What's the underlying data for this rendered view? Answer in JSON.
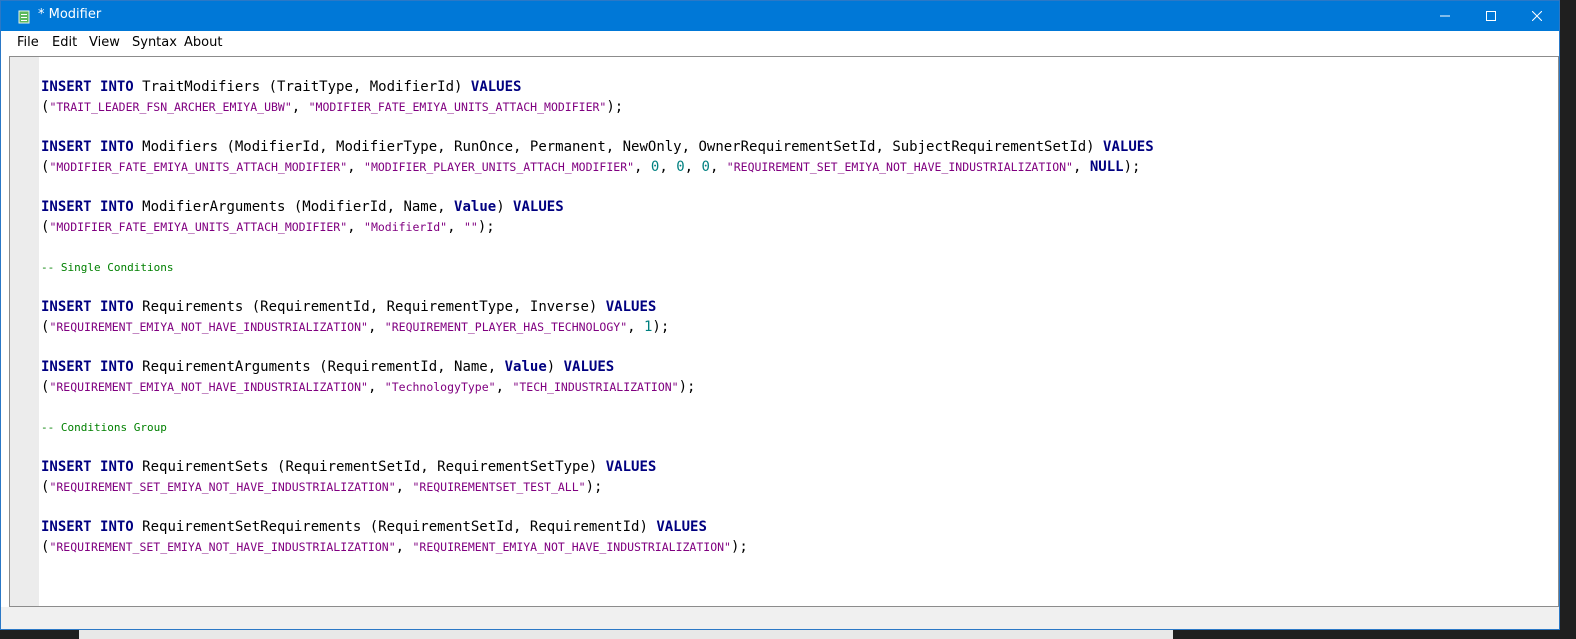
{
  "window": {
    "title": "* Modifier",
    "icon": "notepad-icon",
    "controls": [
      "minimize-icon",
      "maximize-icon",
      "close-icon"
    ]
  },
  "menu": {
    "file": "File",
    "edit": "Edit",
    "view": "View",
    "syntax": "Syntax",
    "about": "About"
  },
  "colors": {
    "titlebar": "#0078d7",
    "keyword": "#000080",
    "string": "#800080",
    "number": "#008080",
    "comment": "#008000"
  },
  "code": {
    "l1": [
      {
        "t": "kw",
        "v": "INSERT"
      },
      {
        "t": "p",
        "v": " "
      },
      {
        "t": "kw",
        "v": "INTO"
      },
      {
        "t": "p",
        "v": " TraitModifiers (TraitType, ModifierId) "
      },
      {
        "t": "kw",
        "v": "VALUES"
      }
    ],
    "l2": [
      {
        "t": "p",
        "v": "("
      },
      {
        "t": "str",
        "v": "\"TRAIT_LEADER_FSN_ARCHER_EMIYA_UBW\""
      },
      {
        "t": "p",
        "v": ", "
      },
      {
        "t": "str",
        "v": "\"MODIFIER_FATE_EMIYA_UNITS_ATTACH_MODIFIER\""
      },
      {
        "t": "p",
        "v": ");"
      }
    ],
    "l3": [
      {
        "t": "kw",
        "v": "INSERT"
      },
      {
        "t": "p",
        "v": " "
      },
      {
        "t": "kw",
        "v": "INTO"
      },
      {
        "t": "p",
        "v": " Modifiers (ModifierId, ModifierType, RunOnce, Permanent, NewOnly, OwnerRequirementSetId, SubjectRequirementSetId) "
      },
      {
        "t": "kw",
        "v": "VALUES"
      }
    ],
    "l4": [
      {
        "t": "p",
        "v": "("
      },
      {
        "t": "str",
        "v": "\"MODIFIER_FATE_EMIYA_UNITS_ATTACH_MODIFIER\""
      },
      {
        "t": "p",
        "v": ", "
      },
      {
        "t": "str",
        "v": "\"MODIFIER_PLAYER_UNITS_ATTACH_MODIFIER\""
      },
      {
        "t": "p",
        "v": ", "
      },
      {
        "t": "num",
        "v": "0"
      },
      {
        "t": "p",
        "v": ", "
      },
      {
        "t": "num",
        "v": "0"
      },
      {
        "t": "p",
        "v": ", "
      },
      {
        "t": "num",
        "v": "0"
      },
      {
        "t": "p",
        "v": ", "
      },
      {
        "t": "str",
        "v": "\"REQUIREMENT_SET_EMIYA_NOT_HAVE_INDUSTRIALIZATION\""
      },
      {
        "t": "p",
        "v": ", "
      },
      {
        "t": "kw",
        "v": "NULL"
      },
      {
        "t": "p",
        "v": ");"
      }
    ],
    "l5": [
      {
        "t": "kw",
        "v": "INSERT"
      },
      {
        "t": "p",
        "v": " "
      },
      {
        "t": "kw",
        "v": "INTO"
      },
      {
        "t": "p",
        "v": " ModifierArguments (ModifierId, Name, "
      },
      {
        "t": "kw",
        "v": "Value"
      },
      {
        "t": "p",
        "v": ") "
      },
      {
        "t": "kw",
        "v": "VALUES"
      }
    ],
    "l6": [
      {
        "t": "p",
        "v": "("
      },
      {
        "t": "str",
        "v": "\"MODIFIER_FATE_EMIYA_UNITS_ATTACH_MODIFIER\""
      },
      {
        "t": "p",
        "v": ", "
      },
      {
        "t": "str",
        "v": "\"ModifierId\""
      },
      {
        "t": "p",
        "v": ", "
      },
      {
        "t": "str",
        "v": "\"\""
      },
      {
        "t": "p",
        "v": ");"
      }
    ],
    "l7": [
      {
        "t": "cmt",
        "v": "-- Single Conditions"
      }
    ],
    "l8": [
      {
        "t": "kw",
        "v": "INSERT"
      },
      {
        "t": "p",
        "v": " "
      },
      {
        "t": "kw",
        "v": "INTO"
      },
      {
        "t": "p",
        "v": " Requirements (RequirementId, RequirementType, Inverse) "
      },
      {
        "t": "kw",
        "v": "VALUES"
      }
    ],
    "l9": [
      {
        "t": "p",
        "v": "("
      },
      {
        "t": "str",
        "v": "\"REQUIREMENT_EMIYA_NOT_HAVE_INDUSTRIALIZATION\""
      },
      {
        "t": "p",
        "v": ", "
      },
      {
        "t": "str",
        "v": "\"REQUIREMENT_PLAYER_HAS_TECHNOLOGY\""
      },
      {
        "t": "p",
        "v": ", "
      },
      {
        "t": "num",
        "v": "1"
      },
      {
        "t": "p",
        "v": ");"
      }
    ],
    "l10": [
      {
        "t": "kw",
        "v": "INSERT"
      },
      {
        "t": "p",
        "v": " "
      },
      {
        "t": "kw",
        "v": "INTO"
      },
      {
        "t": "p",
        "v": " RequirementArguments (RequirementId, Name, "
      },
      {
        "t": "kw",
        "v": "Value"
      },
      {
        "t": "p",
        "v": ") "
      },
      {
        "t": "kw",
        "v": "VALUES"
      }
    ],
    "l11": [
      {
        "t": "p",
        "v": "("
      },
      {
        "t": "str",
        "v": "\"REQUIREMENT_EMIYA_NOT_HAVE_INDUSTRIALIZATION\""
      },
      {
        "t": "p",
        "v": ", "
      },
      {
        "t": "str",
        "v": "\"TechnologyType\""
      },
      {
        "t": "p",
        "v": ", "
      },
      {
        "t": "str",
        "v": "\"TECH_INDUSTRIALIZATION\""
      },
      {
        "t": "p",
        "v": ");"
      }
    ],
    "l12": [
      {
        "t": "cmt",
        "v": "-- Conditions Group"
      }
    ],
    "l13": [
      {
        "t": "kw",
        "v": "INSERT"
      },
      {
        "t": "p",
        "v": " "
      },
      {
        "t": "kw",
        "v": "INTO"
      },
      {
        "t": "p",
        "v": " RequirementSets (RequirementSetId, RequirementSetType) "
      },
      {
        "t": "kw",
        "v": "VALUES"
      }
    ],
    "l14": [
      {
        "t": "p",
        "v": "("
      },
      {
        "t": "str",
        "v": "\"REQUIREMENT_SET_EMIYA_NOT_HAVE_INDUSTRIALIZATION\""
      },
      {
        "t": "p",
        "v": ", "
      },
      {
        "t": "str",
        "v": "\"REQUIREMENTSET_TEST_ALL\""
      },
      {
        "t": "p",
        "v": ");"
      }
    ],
    "l15": [
      {
        "t": "kw",
        "v": "INSERT"
      },
      {
        "t": "p",
        "v": " "
      },
      {
        "t": "kw",
        "v": "INTO"
      },
      {
        "t": "p",
        "v": " RequirementSetRequirements (RequirementSetId, RequirementId) "
      },
      {
        "t": "kw",
        "v": "VALUES"
      }
    ],
    "l16": [
      {
        "t": "p",
        "v": "("
      },
      {
        "t": "str",
        "v": "\"REQUIREMENT_SET_EMIYA_NOT_HAVE_INDUSTRIALIZATION\""
      },
      {
        "t": "p",
        "v": ", "
      },
      {
        "t": "str",
        "v": "\"REQUIREMENT_EMIYA_NOT_HAVE_INDUSTRIALIZATION\""
      },
      {
        "t": "p",
        "v": ");"
      }
    ]
  }
}
